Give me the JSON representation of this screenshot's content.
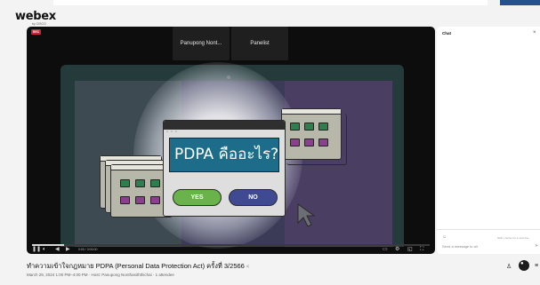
{
  "app": {
    "logo": "webex",
    "logo_sub": "by CISCO"
  },
  "video": {
    "rec_label": "REC",
    "participants": [
      "Panupong Nont...",
      "Panelist"
    ],
    "slide": {
      "question": "PDPA คืออะไร?",
      "yes_label": "YES",
      "no_label": "NO"
    },
    "controls": {
      "time": "0:00 / 3:00:00",
      "progress_fraction": 0.08
    }
  },
  "meeting": {
    "title": "ทำความเข้าใจกฎหมาย PDPA (Personal Data Protection Act) ครั้งที่ 3/2566",
    "meta": "March 29, 2024 1:00 PM–4:00 PM · Host: Panupong Nonthasiththichai · 1 attendee"
  },
  "chat": {
    "title": "Chat",
    "hint": "Shift + Enter for a new line",
    "input_placeholder": "Send a message to all"
  },
  "colors": {
    "accent_blue": "#2a4f8f",
    "yes_green": "#6ab24a",
    "no_blue": "#3f4a92",
    "rec_red": "#d3213a"
  }
}
